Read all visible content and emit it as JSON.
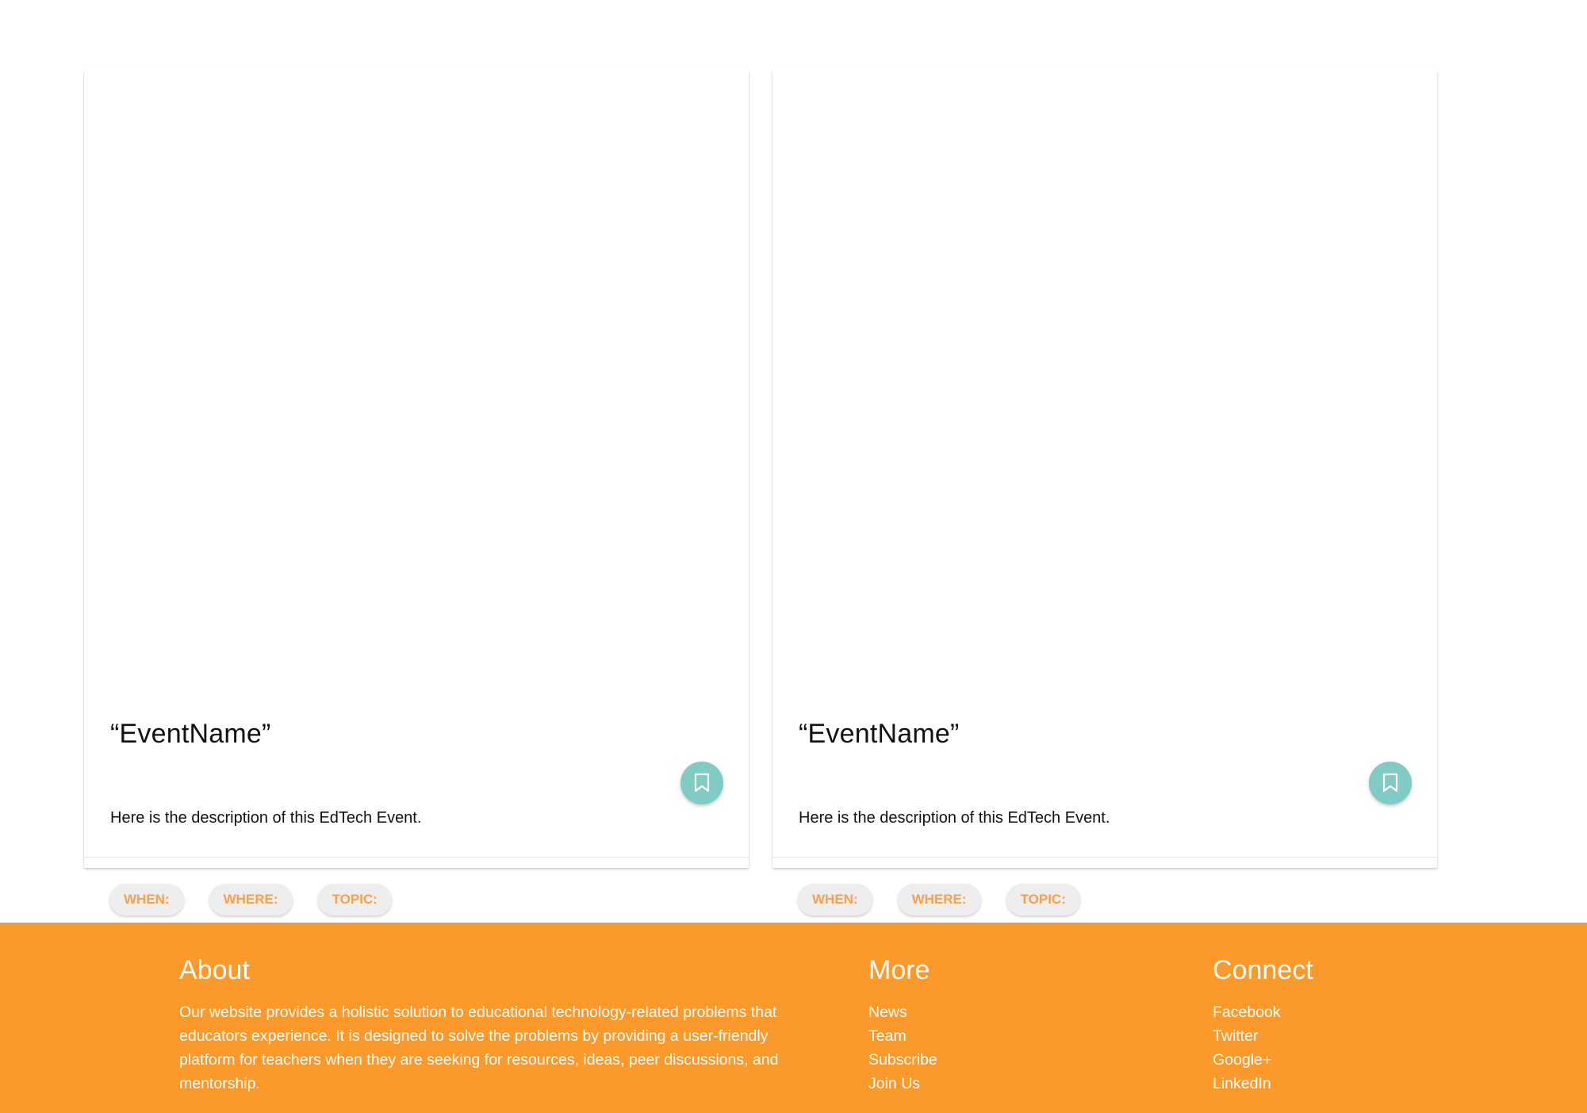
{
  "cards": [
    {
      "title": "“EventName”",
      "description": "Here is the description of this EdTech Event.",
      "chips": [
        "WHEN:",
        "WHERE:",
        "TOPIC:"
      ],
      "bookmark_icon": "bookmark-icon"
    },
    {
      "title": "“EventName”",
      "description": "Here is the description of this EdTech Event.",
      "chips": [
        "WHEN:",
        "WHERE:",
        "TOPIC:"
      ],
      "bookmark_icon": "bookmark-icon"
    }
  ],
  "footer": {
    "about": {
      "heading": "About",
      "text": "Our website provides a holistic solution to educational technology-related problems that educators experience. It is designed to solve the problems by providing a user-friendly platform for teachers when they are seeking for resources, ideas, peer discussions, and mentorship."
    },
    "more": {
      "heading": "More",
      "links": [
        "News",
        "Team",
        "Subscribe",
        "Join Us"
      ]
    },
    "connect": {
      "heading": "Connect",
      "links": [
        "Facebook",
        "Twitter",
        "Google+",
        "LinkedIn"
      ]
    }
  },
  "colors": {
    "footer_bg": "#fb992a",
    "fab_bg": "#80cbc4",
    "chip_text": "#f8a04a",
    "chip_bg": "#eeeeee"
  }
}
